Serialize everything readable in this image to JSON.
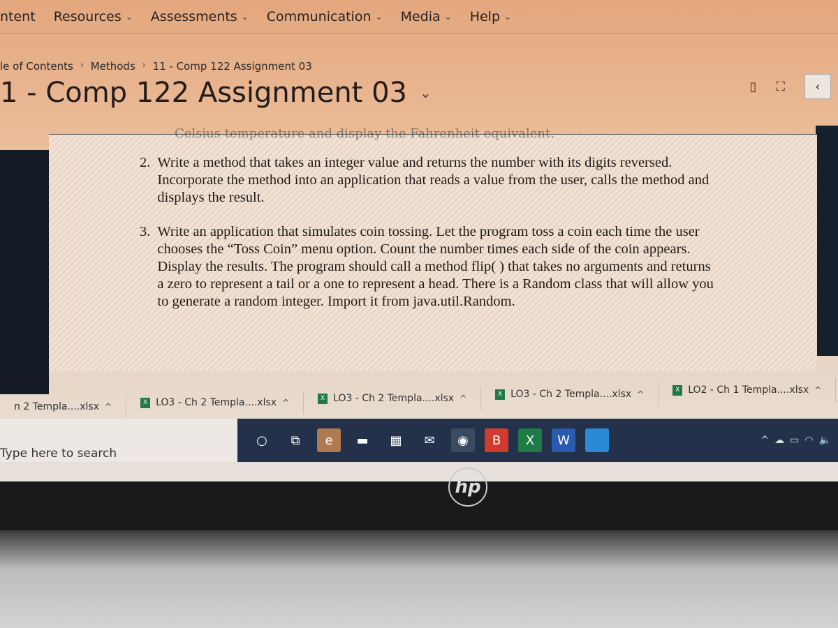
{
  "nav": {
    "items": [
      {
        "label": "ntent",
        "chev": false
      },
      {
        "label": "Resources",
        "chev": true
      },
      {
        "label": "Assessments",
        "chev": true
      },
      {
        "label": "Communication",
        "chev": true
      },
      {
        "label": "Media",
        "chev": true
      },
      {
        "label": "Help",
        "chev": true
      }
    ]
  },
  "breadcrumb": [
    "le of Contents",
    "Methods",
    "11 - Comp 122 Assignment 03"
  ],
  "page_title": "1 - Comp 122 Assignment 03",
  "doc": {
    "cut_line": "Celsius temperature and display the Fahrenheit equivalent.",
    "items": [
      {
        "num": "2.",
        "text": "Write a method that takes an integer value and returns the number with its digits reversed. Incorporate the method into an application that reads a value from the user, calls the method and displays the result."
      },
      {
        "num": "3.",
        "text": "Write an application that simulates coin tossing. Let the program toss a coin each time the user chooses the “Toss Coin” menu option. Count the number times each side of the coin appears. Display the results. The program should call a method flip( ) that takes no arguments and returns a zero to represent a tail or a one to represent a head. There is a Random class that will allow you to generate a random integer. Import it from java.util.Random."
      }
    ]
  },
  "downloads": [
    "n 2 Templa....xlsx",
    "LO3 - Ch 2 Templa....xlsx",
    "LO3 - Ch 2 Templa....xlsx",
    "LO3 - Ch 2 Templa....xlsx",
    "LO2 - Ch 1 Templa....xlsx"
  ],
  "taskbar": {
    "search_placeholder": "Type here to search",
    "apps": [
      {
        "name": "cortana",
        "glyph": "○",
        "color": "#23324a"
      },
      {
        "name": "task-view",
        "glyph": "⧉",
        "color": "#23324a"
      },
      {
        "name": "edge",
        "glyph": "e",
        "color": "#b07a50"
      },
      {
        "name": "file-explorer",
        "glyph": "▬",
        "color": "#23324a"
      },
      {
        "name": "store",
        "glyph": "▦",
        "color": "#23324a"
      },
      {
        "name": "mail",
        "glyph": "✉",
        "color": "#23324a"
      },
      {
        "name": "chrome",
        "glyph": "◉",
        "color": "#3a4a60"
      },
      {
        "name": "bitdefender",
        "glyph": "B",
        "color": "#d13b2e"
      },
      {
        "name": "excel",
        "glyph": "X",
        "color": "#1f7a45"
      },
      {
        "name": "word",
        "glyph": "W",
        "color": "#2a5bb0"
      },
      {
        "name": "app",
        "glyph": "",
        "color": "#2a8ad8"
      }
    ]
  },
  "brand": "hp"
}
